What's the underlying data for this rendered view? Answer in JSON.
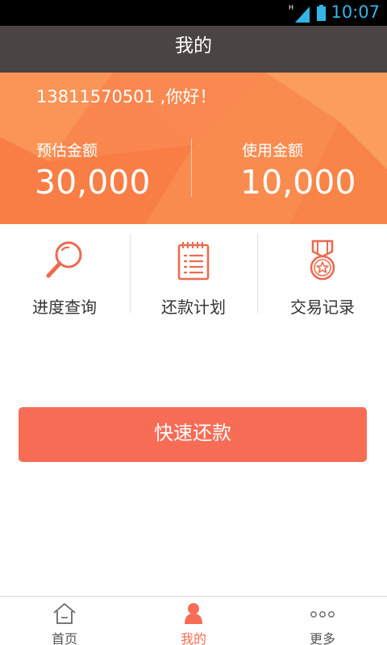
{
  "status_bar": {
    "time": "10:07",
    "network_indicator": "H",
    "clock_color": "#33b5e5",
    "icons": [
      "signal-icon",
      "battery-icon"
    ]
  },
  "header": {
    "title": "我的"
  },
  "account": {
    "greeting": "13811570501 ,你好！",
    "estimated_amount_label": "预估金额",
    "estimated_amount_value": "30,000",
    "used_amount_label": "使用金额",
    "used_amount_value": "10,000"
  },
  "shortcuts": [
    {
      "label": "进度查询",
      "icon": "magnifier-icon"
    },
    {
      "label": "还款计划",
      "icon": "notepad-icon"
    },
    {
      "label": "交易记录",
      "icon": "medal-icon"
    }
  ],
  "actions": {
    "quick_repay_label": "快速还款"
  },
  "tabbar": {
    "tabs": [
      {
        "label": "首页",
        "icon": "home-icon",
        "active": false
      },
      {
        "label": "我的",
        "icon": "user-icon",
        "active": true
      },
      {
        "label": "更多",
        "icon": "more-dots-icon",
        "active": false
      }
    ]
  },
  "colors": {
    "title_bar_bg": "#4a4544",
    "hero_orange": "#f9874f",
    "accent": "#f76c55",
    "icon_line": "#ee6a4f"
  }
}
